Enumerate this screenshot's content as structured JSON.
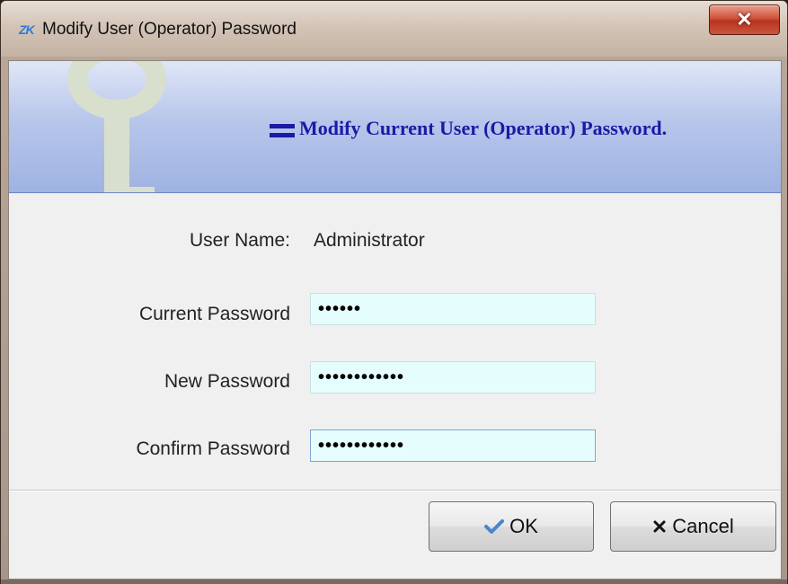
{
  "window": {
    "app_icon_text": "ZK",
    "title": "Modify User (Operator) Password",
    "close_glyph": "✕"
  },
  "banner": {
    "heading": "Modify Current User (Operator)  Password.",
    "icon": "key-icon",
    "heading_color": "#1a1aa6"
  },
  "form": {
    "user_name_label": "User Name:",
    "user_name_value": "Administrator",
    "current_password_label": "Current Password",
    "current_password_value": "••••••",
    "new_password_label": "New Password",
    "new_password_value": "••••••••••••",
    "confirm_password_label": "Confirm Password",
    "confirm_password_value": "••••••••••••",
    "field_background": "#e6fdfd"
  },
  "buttons": {
    "ok_label": "OK",
    "ok_icon": "check-icon",
    "cancel_label": "Cancel",
    "cancel_icon": "close-x-icon"
  }
}
